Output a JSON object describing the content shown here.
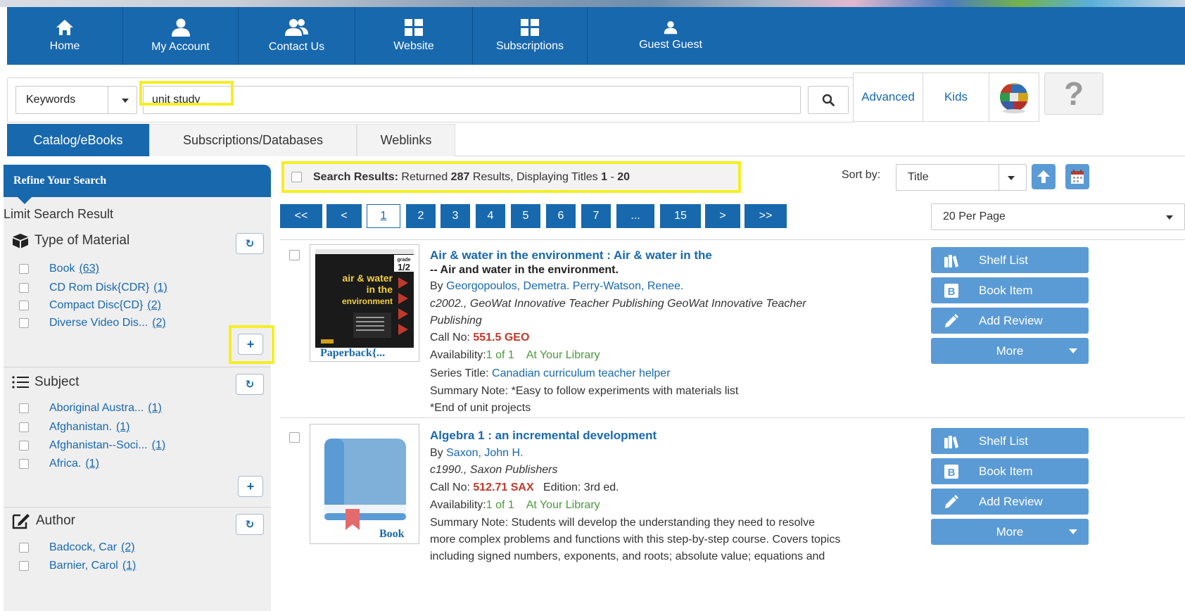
{
  "nav": {
    "items": [
      {
        "label": "Home",
        "icon": "home-icon"
      },
      {
        "label": "My Account",
        "icon": "user-icon"
      },
      {
        "label": "Contact Us",
        "icon": "contacts-icon"
      },
      {
        "label": "Website",
        "icon": "grid-icon"
      },
      {
        "label": "Subscriptions",
        "icon": "grid-icon"
      },
      {
        "label": "Guest Guest",
        "icon": "user-icon"
      }
    ]
  },
  "search": {
    "type_selected": "Keywords",
    "query": "unit study",
    "advanced_label": "Advanced",
    "kids_label": "Kids",
    "help_label": "?"
  },
  "tabs": [
    {
      "label": "Catalog/eBooks",
      "active": true
    },
    {
      "label": "Subscriptions/Databases",
      "active": false
    },
    {
      "label": "Weblinks",
      "active": false
    }
  ],
  "sidebar": {
    "refine_title": "Refine Your Search",
    "limit_label": "Limit Search Result",
    "facets": [
      {
        "title": "Type of Material",
        "items": [
          {
            "label": "Book",
            "count": "(63)"
          },
          {
            "label": "CD Rom Disk{CDR}",
            "count": "(1)"
          },
          {
            "label": "Compact Disc{CD}",
            "count": "(2)"
          },
          {
            "label": "Diverse Video Dis...",
            "count": "(2)"
          }
        ]
      },
      {
        "title": "Subject",
        "items": [
          {
            "label": "Aboriginal Austra...",
            "count": "(1)"
          },
          {
            "label": "Afghanistan.",
            "count": "(1)"
          },
          {
            "label": "Afghanistan--Soci...",
            "count": "(1)"
          },
          {
            "label": "Africa.",
            "count": "(1)"
          }
        ]
      },
      {
        "title": "Author",
        "items": [
          {
            "label": "Badcock, Car",
            "count": "(2)"
          },
          {
            "label": "Barnier, Carol",
            "count": "(1)"
          }
        ]
      }
    ],
    "reset_glyph": "↻",
    "plus_glyph": "+"
  },
  "results_header": {
    "label": "Search Results:",
    "returned_text": "Returned",
    "total": "287",
    "results_text": "Results, Displaying Titles",
    "from": "1",
    "dash": "-",
    "to": "20",
    "sort_label": "Sort by:",
    "sort_value": "Title",
    "per_page": "20 Per Page"
  },
  "pagination": [
    "<<",
    "<",
    "1",
    "2",
    "3",
    "4",
    "5",
    "6",
    "7",
    "...",
    "15",
    ">",
    ">>"
  ],
  "results": [
    {
      "title": "Air & water in the environment : Air & water in the",
      "subtitle": "-- Air and water in the environment.",
      "by_label": "By",
      "authors": "Georgopoulos, Demetra.  Perry-Watson, Renee.",
      "pub_line1": "c2002., GeoWat Innovative Teacher Publishing GeoWat Innovative Teacher",
      "pub_line2": "Publishing",
      "call_label": "Call No:",
      "call_no": "551.5 GEO",
      "edition": "",
      "avail_label": "Availability:",
      "avail": "1 of 1",
      "location": "At Your Library",
      "series_label": "Series Title:",
      "series": "Canadian curriculum teacher helper",
      "summary_label": "Summary Note:",
      "summary_line1": "*Easy to follow experiments with materials list",
      "summary_line2": "*End of unit projects",
      "format": "Paperback{...",
      "cover_grade": "grade 1/2",
      "cover_title": "air & water in the environment"
    },
    {
      "title": "Algebra 1 : an incremental development",
      "by_label": "By",
      "authors": "Saxon, John H.",
      "pub_line1": "c1990., Saxon Publishers",
      "call_label": "Call No:",
      "call_no": "512.71 SAX",
      "edition": "Edition: 3rd ed.",
      "avail_label": "Availability:",
      "avail": "1 of 1",
      "location": "At Your Library",
      "summary_label": "Summary Note:",
      "summary_line1": "Students will develop the understanding they need to resolve",
      "summary_line2": "more complex problems and functions with this step-by-step course. Covers topics",
      "summary_line3": "including signed numbers, exponents, and roots; absolute value; equations and",
      "format": "Book"
    }
  ],
  "actions": {
    "shelf_list": "Shelf List",
    "book_item": "Book Item",
    "add_review": "Add Review",
    "more": "More"
  },
  "colors": {
    "primary": "#1868ae",
    "button": "#5b9bd5",
    "highlight": "#f5ee24",
    "call_no": "#c0392b",
    "availability": "#4a9a3c"
  }
}
